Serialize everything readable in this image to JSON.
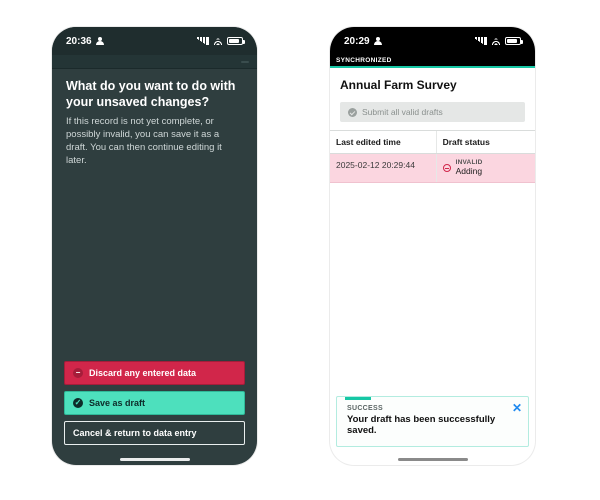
{
  "left": {
    "status_time": "20:36",
    "sync_hint": "",
    "sync_pill": "",
    "title": "What do you want to do with your unsaved changes?",
    "subtitle": "If this record is not yet complete, or possibly invalid, you can save it as a draft. You can then continue editing it later.",
    "discard": "Discard any entered data",
    "save": "Save as draft",
    "cancel": "Cancel & return to data entry"
  },
  "right": {
    "status_time": "20:29",
    "sync_label": "SYNCHRONIZED",
    "page_title": "Annual Farm Survey",
    "submit_label": "Submit all valid drafts",
    "col_left": "Last edited time",
    "col_right": "Draft status",
    "row_time": "2025-02-12 20:29:44",
    "row_status_tag": "INVALID",
    "row_status_action": "Adding",
    "toast_label": "SUCCESS",
    "toast_msg": "Your draft has been successfully saved."
  }
}
